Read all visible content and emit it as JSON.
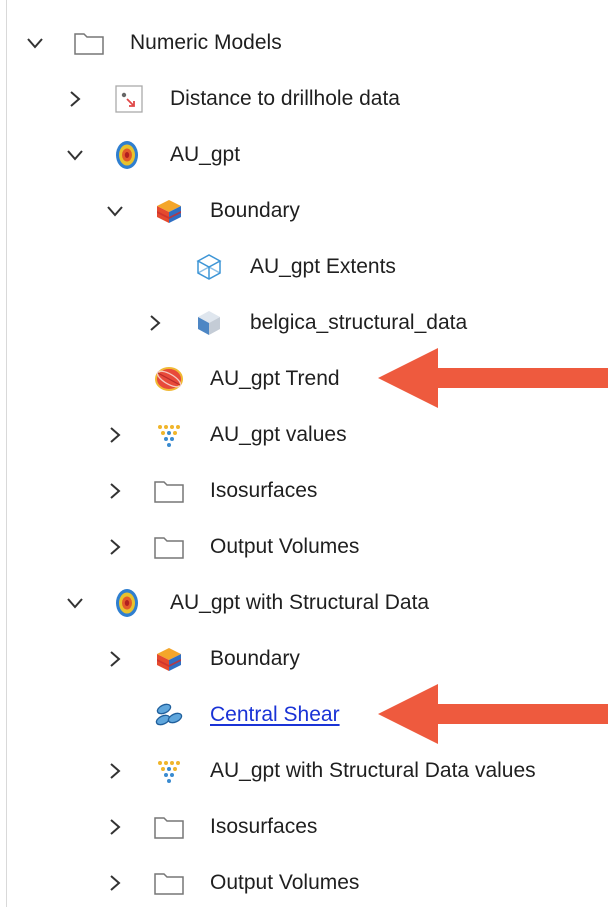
{
  "tree": {
    "numeric_models": "Numeric Models",
    "distance": "Distance to drillhole data",
    "au_gpt": "AU_gpt",
    "boundary": "Boundary",
    "extents": "AU_gpt Extents",
    "belgica": "belgica_structural_data",
    "trend": "AU_gpt Trend",
    "values": "AU_gpt values",
    "isosurfaces": "Isosurfaces",
    "output_volumes": "Output Volumes",
    "au_gpt_struct": "AU_gpt with Structural Data",
    "boundary2": "Boundary",
    "central_shear": "Central Shear",
    "struct_values": "AU_gpt with Structural Data values",
    "isosurfaces2": "Isosurfaces",
    "output_volumes2": "Output Volumes"
  },
  "colors": {
    "arrow": "#ee5a3e",
    "link": "#1a33d6"
  }
}
